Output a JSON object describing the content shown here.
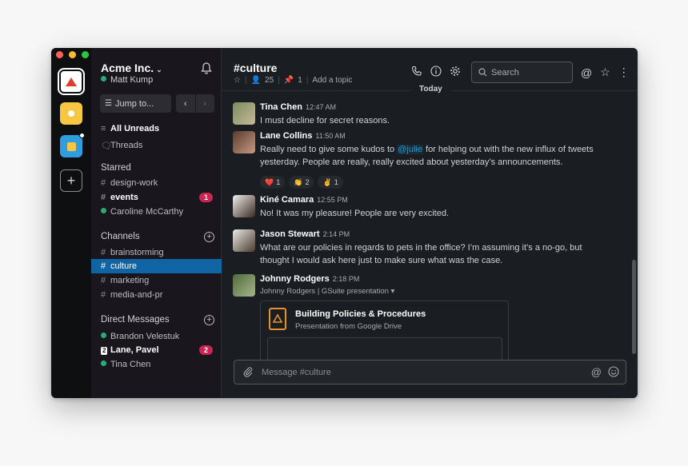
{
  "team": {
    "name": "Acme Inc.",
    "user": "Matt Kump"
  },
  "jump_label": "Jump to...",
  "nav": {
    "unreads": "All Unreads",
    "threads": "Threads"
  },
  "starred": {
    "header": "Starred",
    "items": [
      {
        "label": "design-work",
        "type": "channel"
      },
      {
        "label": "events",
        "type": "channel",
        "bold": true,
        "badge": "1"
      },
      {
        "label": "Caroline McCarthy",
        "type": "dm"
      }
    ]
  },
  "channels": {
    "header": "Channels",
    "items": [
      {
        "label": "brainstorming"
      },
      {
        "label": "culture",
        "active": true
      },
      {
        "label": "marketing"
      },
      {
        "label": "media-and-pr"
      }
    ]
  },
  "dms": {
    "header": "Direct Messages",
    "items": [
      {
        "label": "Brandon Velestuk"
      },
      {
        "label": "Lane, Pavel",
        "bold": true,
        "count_icon": "2",
        "badge": "2"
      },
      {
        "label": "Tina Chen"
      }
    ]
  },
  "channel": {
    "title": "#culture",
    "members": "25",
    "pins": "1",
    "topic_link": "Add a topic"
  },
  "search_placeholder": "Search",
  "divider_label": "Today",
  "messages": [
    {
      "name": "Tina Chen",
      "time": "12:47 AM",
      "text": "I must decline for secret reasons."
    },
    {
      "name": "Lane Collins",
      "time": "11:50 AM",
      "text_before": "Really need to give some kudos to ",
      "mention": "@julie",
      "text_after": " for helping out with the new influx of tweets",
      "text_line2": "yesterday. People are really, really excited about yesterday’s announcements.",
      "reactions": [
        {
          "emoji": "❤️",
          "count": "1"
        },
        {
          "emoji": "👏",
          "count": "2"
        },
        {
          "emoji": "✌️",
          "count": "1"
        }
      ]
    },
    {
      "name": "Kiné Camara",
      "time": "12:55 PM",
      "text": "No! It was my pleasure! People are very excited."
    },
    {
      "name": "Jason Stewart",
      "time": "2:14 PM",
      "text": "What are our policies in regards to pets in the office? I’m assuming it’s a no-go, but",
      "text_line2": "thought I would ask here just to make sure what was the case."
    },
    {
      "name": "Johnny Rodgers",
      "time": "2:18 PM",
      "subline": "Johnny Rodgers | GSuite presentation",
      "attachment": {
        "title": "Building Policies & Procedures",
        "subtitle": "Presentation from Google Drive"
      }
    }
  ],
  "composer_placeholder": "Message #culture",
  "colors": {
    "accent": "#1164a3",
    "badge": "#cd2553",
    "presence": "#2bac76",
    "mention": "#1d9bd1"
  }
}
